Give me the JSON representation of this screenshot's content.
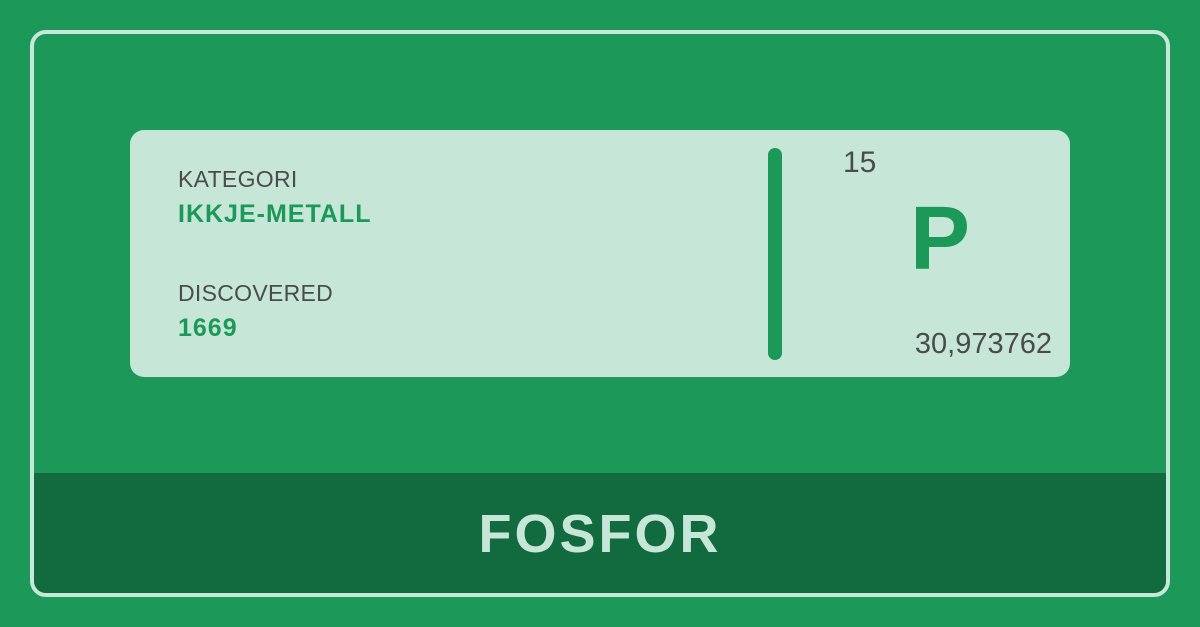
{
  "element": {
    "category_label": "KATEGORI",
    "category_value": "IKKJE-METALL",
    "discovered_label": "DISCOVERED",
    "discovered_value": "1669",
    "atomic_number": "15",
    "symbol": "P",
    "atomic_mass": "30,973762",
    "name": "FOSFOR"
  },
  "colors": {
    "background": "#1c9958",
    "card": "#c6e7d8",
    "name_bar": "#126b3e",
    "accent": "#1c9958",
    "text_gray": "#4b4b4b"
  }
}
